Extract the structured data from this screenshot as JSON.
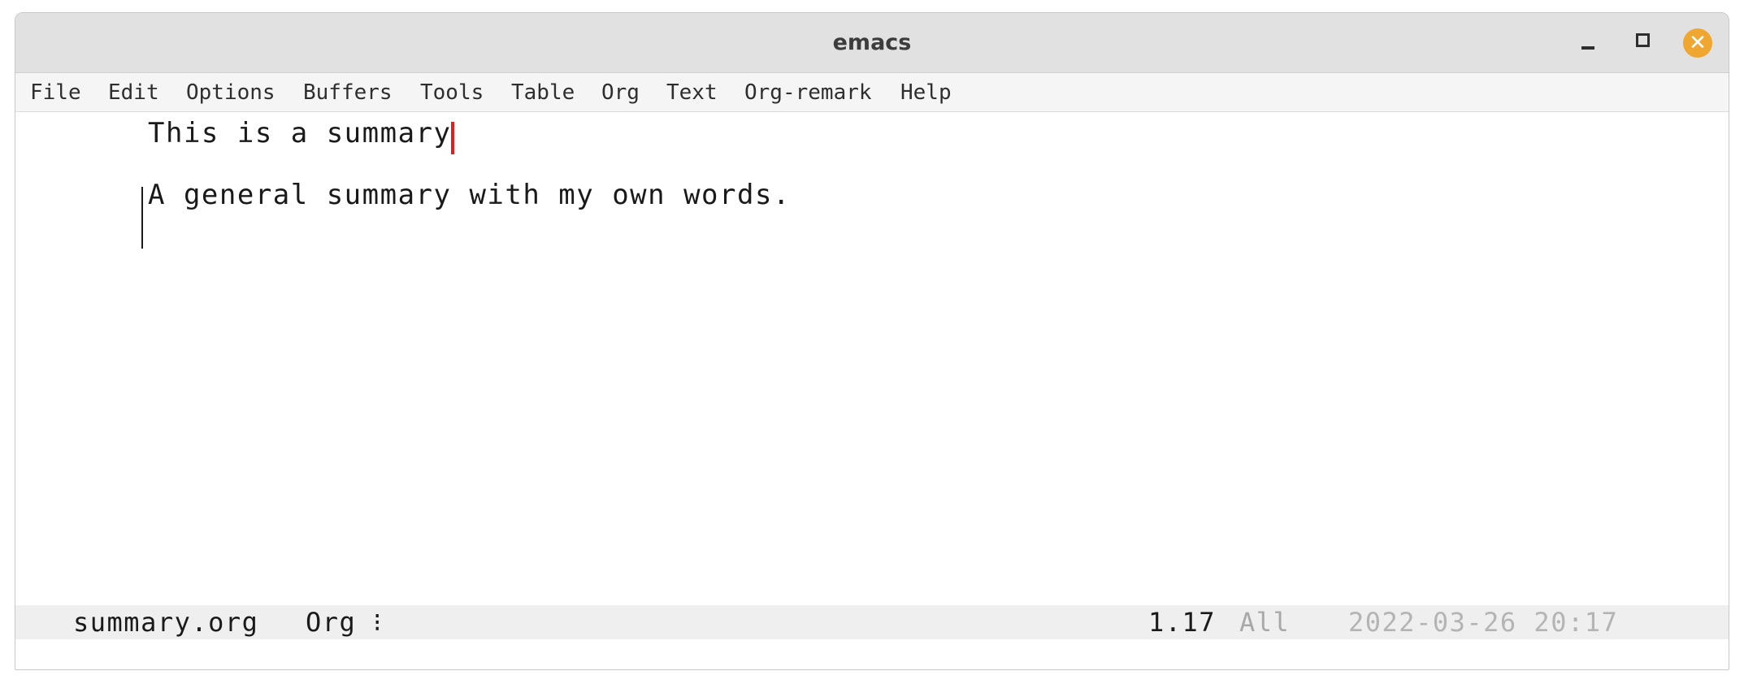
{
  "window": {
    "title": "emacs"
  },
  "menubar": {
    "items": [
      "File",
      "Edit",
      "Options",
      "Buffers",
      "Tools",
      "Table",
      "Org",
      "Text",
      "Org-remark",
      "Help"
    ]
  },
  "editor": {
    "lines": [
      "This is a summary",
      "A general summary with my own words."
    ]
  },
  "modeline": {
    "buffer_name": "summary.org",
    "major_mode": "Org ⁝",
    "position": "1.17",
    "scroll": "All",
    "datetime": "2022-03-26 20:17"
  },
  "colors": {
    "cursor": "#e0201e",
    "close_button": "#f0a732",
    "titlebar": "#e1e1e1",
    "modeline": "#efefef"
  }
}
